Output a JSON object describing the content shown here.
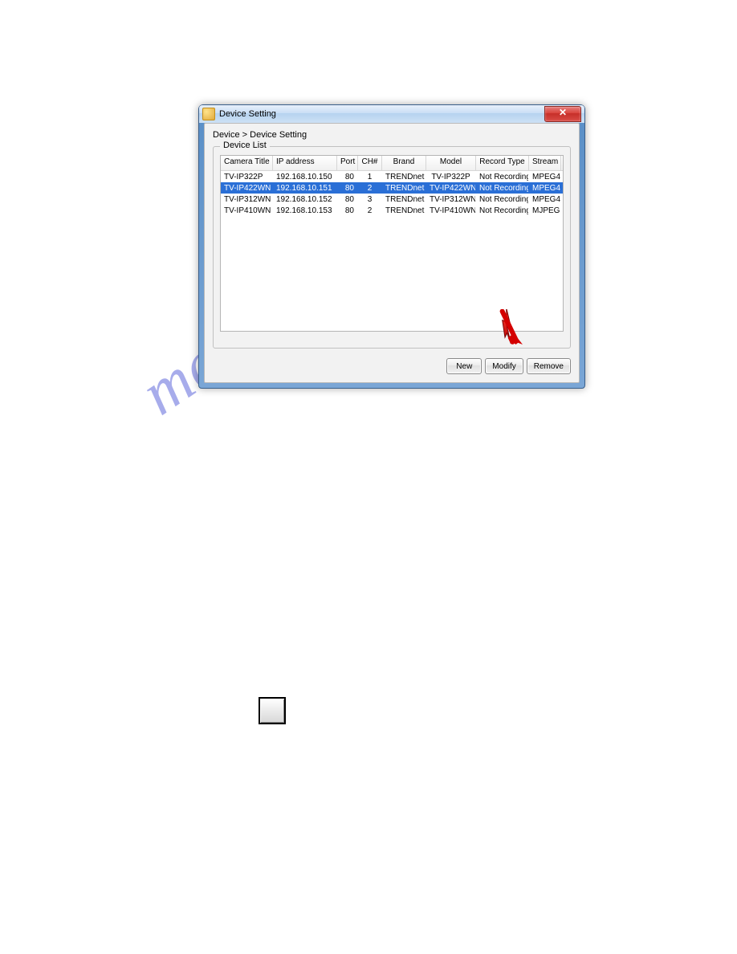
{
  "window": {
    "title": "Device Setting",
    "breadcrumb": "Device > Device Setting",
    "group_label": "Device List"
  },
  "columns": {
    "title": "Camera Title",
    "ip": "IP address",
    "port": "Port",
    "ch": "CH#",
    "brand": "Brand",
    "model": "Model",
    "rec": "Record Type",
    "stream": "Stream"
  },
  "rows": [
    {
      "title": "TV-IP322P",
      "ip": "192.168.10.150",
      "port": "80",
      "ch": "1",
      "brand": "TRENDnet",
      "model": "TV-IP322P",
      "rec": "Not Recording",
      "stream": "MPEG4",
      "selected": false
    },
    {
      "title": "TV-IP422WN",
      "ip": "192.168.10.151",
      "port": "80",
      "ch": "2",
      "brand": "TRENDnet",
      "model": "TV-IP422WN",
      "rec": "Not Recording",
      "stream": "MPEG4",
      "selected": true
    },
    {
      "title": "TV-IP312WN",
      "ip": "192.168.10.152",
      "port": "80",
      "ch": "3",
      "brand": "TRENDnet",
      "model": "TV-IP312WN",
      "rec": "Not Recording",
      "stream": "MPEG4",
      "selected": false
    },
    {
      "title": "TV-IP410WN",
      "ip": "192.168.10.153",
      "port": "80",
      "ch": "2",
      "brand": "TRENDnet",
      "model": "TV-IP410WN",
      "rec": "Not Recording",
      "stream": "MJPEG",
      "selected": false
    }
  ],
  "buttons": {
    "new": "New",
    "modify": "Modify",
    "remove": "Remove"
  },
  "watermark": "manualshive.com"
}
